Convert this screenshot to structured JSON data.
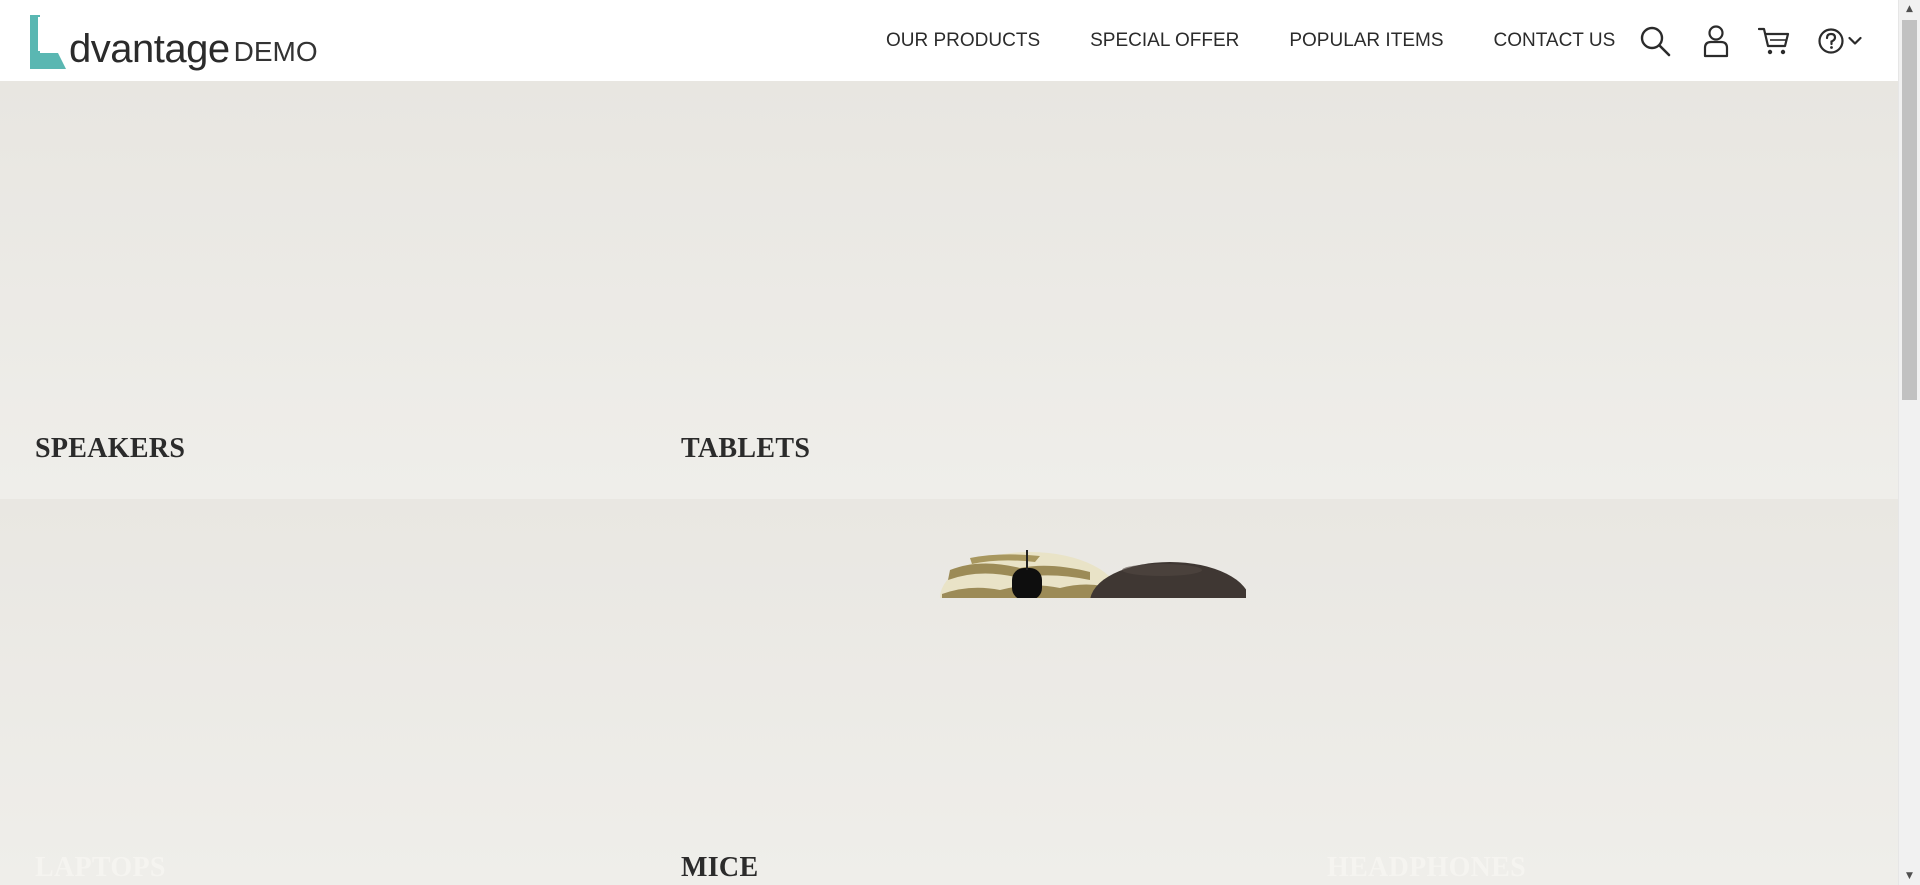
{
  "brand": {
    "word": "dvantage",
    "suffix": "DEMO",
    "accent_color": "#5ab7b2"
  },
  "nav": {
    "items": [
      "OUR PRODUCTS",
      "SPECIAL OFFER",
      "POPULAR ITEMS",
      "CONTACT US"
    ]
  },
  "header_icons": [
    "search-icon",
    "user-icon",
    "cart-icon",
    "help-icon",
    "chevron-down-icon"
  ],
  "categories": {
    "speakers": "SPEAKERS",
    "tablets": "TABLETS",
    "laptops": "LAPTOPS",
    "mice": "MICE",
    "headphones": "HEADPHONES"
  },
  "colors": {
    "background": "#ebe9e4",
    "text": "#2b2b2b"
  }
}
